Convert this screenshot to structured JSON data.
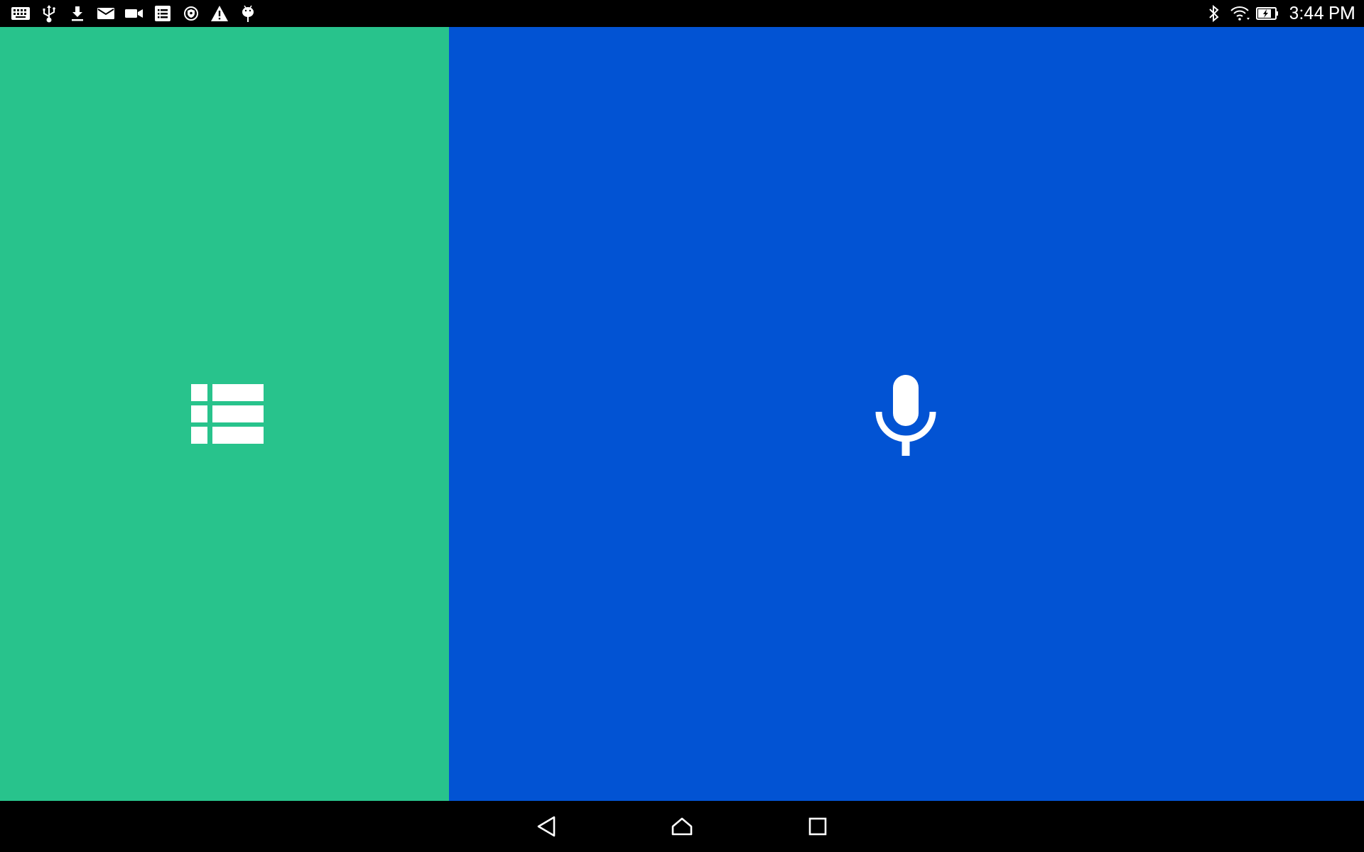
{
  "status_bar": {
    "notification_icons": [
      "keyboard-icon",
      "usb-icon",
      "download-icon",
      "mail-icon",
      "video-camera-icon",
      "task-list-icon",
      "vpn-shield-icon",
      "warning-icon",
      "android-debug-icon"
    ],
    "system_icons": [
      "bluetooth-icon",
      "wifi-icon",
      "battery-charging-icon"
    ],
    "time": "3:44 PM"
  },
  "panels": {
    "left": {
      "icon": "list-icon",
      "color": "#28C38C"
    },
    "right": {
      "icon": "microphone-icon",
      "color": "#0253D3"
    }
  },
  "nav_bar": {
    "buttons": [
      "back-icon",
      "home-icon",
      "recents-icon"
    ]
  }
}
